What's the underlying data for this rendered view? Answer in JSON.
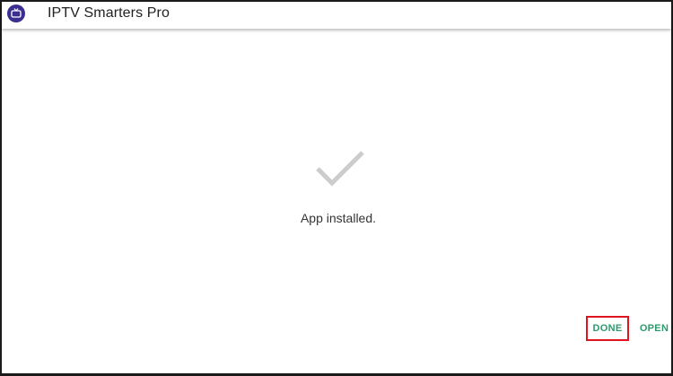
{
  "app_bar": {
    "title": "IPTV Smarters Pro",
    "icon": "iptv-app-icon"
  },
  "status": {
    "icon": "checkmark-icon",
    "message": "App installed."
  },
  "actions": {
    "done_label": "DONE",
    "open_label": "OPEN"
  },
  "colors": {
    "accent": "#2e9a6e",
    "highlight_border": "#e0141e",
    "check": "#cccccc",
    "app_icon_bg": "#3a2f8f"
  }
}
